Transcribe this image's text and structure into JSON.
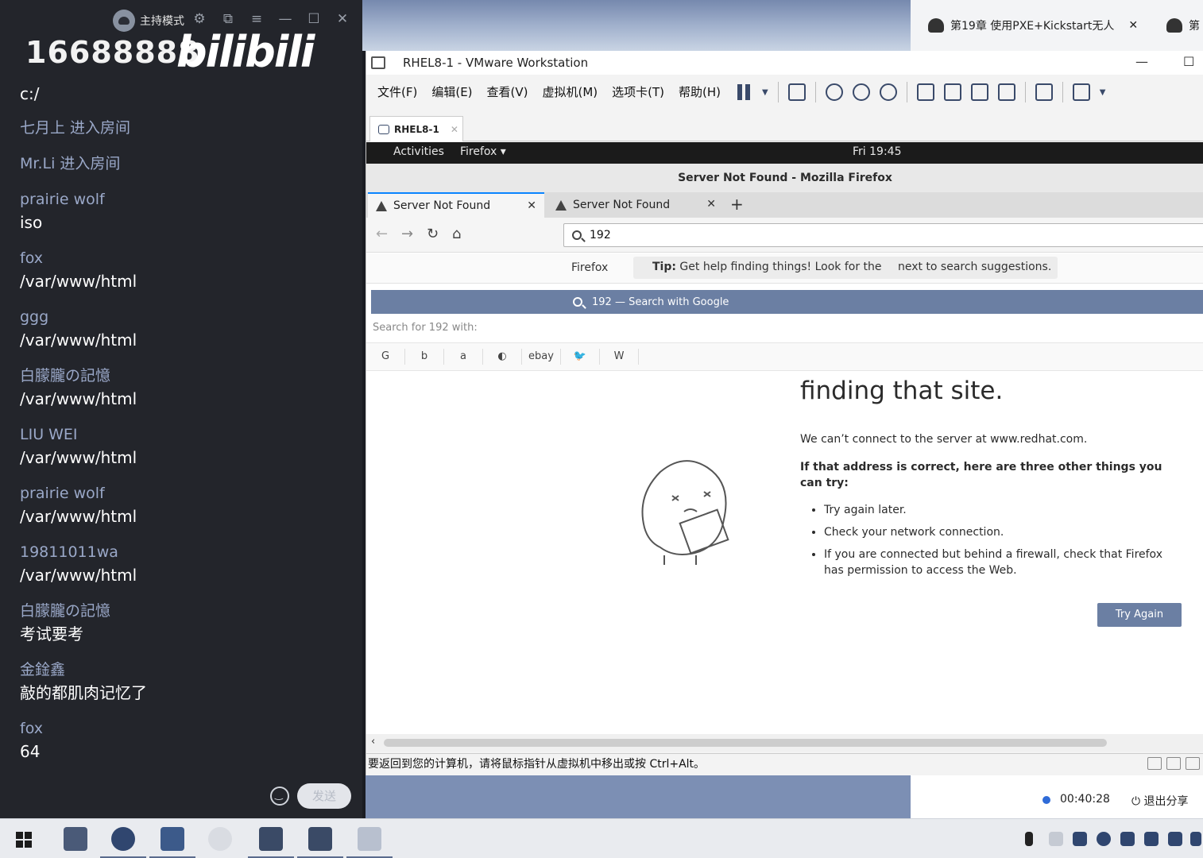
{
  "chat": {
    "host_mode": "主持模式",
    "room_id": "16688888",
    "brand": "bilibili",
    "first_cmd": "c:/",
    "system_messages": [
      "七月上 进入房间",
      "Mr.Li 进入房间"
    ],
    "messages": [
      {
        "user": "prairie wolf",
        "text": "iso"
      },
      {
        "user": "fox",
        "text": "/var/www/html"
      },
      {
        "user": "ggg",
        "text": "/var/www/html"
      },
      {
        "user": "白朦朧の記憶",
        "text": "/var/www/html"
      },
      {
        "user": "LIU WEI",
        "text": "/var/www/html"
      },
      {
        "user": "prairie wolf",
        "text": "/var/www/html"
      },
      {
        "user": "19811011wa",
        "text": "/var/www/html"
      },
      {
        "user": "白朦朧の記憶",
        "text": "考试要考"
      },
      {
        "user": "金鍂鑫",
        "text": "敲的都肌肉记忆了"
      },
      {
        "user": "fox",
        "text": "64"
      }
    ],
    "send_label": "发送"
  },
  "external_tabs": {
    "tab1": "第19章 使用PXE+Kickstart无人",
    "tab2": "第"
  },
  "vmware": {
    "title": "RHEL8-1 - VMware Workstation",
    "menu": [
      "文件(F)",
      "编辑(E)",
      "查看(V)",
      "虚拟机(M)",
      "选项卡(T)",
      "帮助(H)"
    ],
    "vm_tab": "RHEL8-1",
    "status_text": "要返回到您的计算机，请将鼠标指针从虚拟机中移出或按 Ctrl+Alt。"
  },
  "gnome": {
    "activities": "Activities",
    "app": "Firefox ▾",
    "clock": "Fri 19:45"
  },
  "firefox": {
    "window_title": "Server Not Found - Mozilla Firefox",
    "tabs": [
      "Server Not Found",
      "Server Not Found"
    ],
    "url_value": "192",
    "tip_brand": "Firefox",
    "tip_bold": "Tip:",
    "tip_text": "Get help finding things! Look for the",
    "tip_tail": "next to search suggestions.",
    "suggestion": "192 — Search with Google",
    "search_with": "Search for 192 with:",
    "engines": [
      "G",
      "b",
      "a",
      "◐",
      "ebay",
      "🐦",
      "W"
    ]
  },
  "error_page": {
    "title": "finding that site.",
    "line1": "We can’t connect to the server at www.redhat.com.",
    "line2": "If that address is correct, here are three other things you can try:",
    "bullets": [
      "Try again later.",
      "Check your network connection.",
      "If you are connected but behind a firewall, check that Firefox has permission to access the Web."
    ],
    "try_again": "Try Again"
  },
  "share_bar": {
    "timer": "00:40:28",
    "exit": "退出分享"
  }
}
